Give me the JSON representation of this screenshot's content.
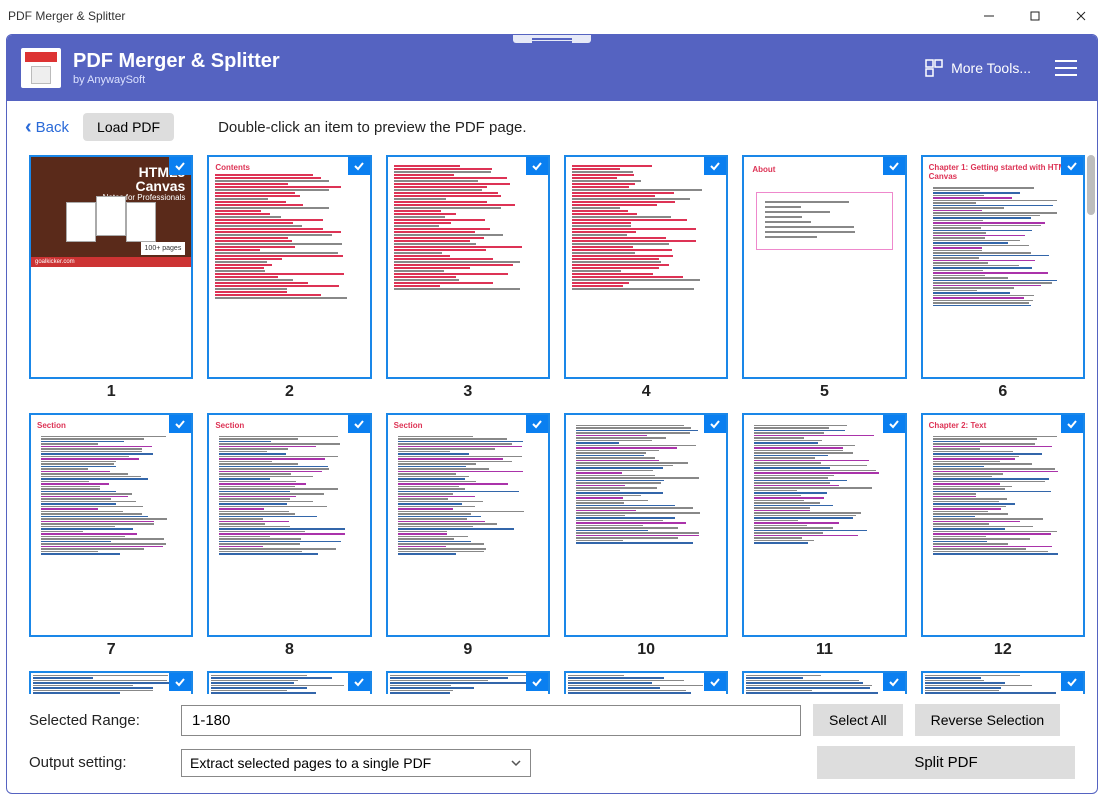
{
  "window": {
    "title": "PDF Merger & Splitter"
  },
  "header": {
    "title": "PDF Merger & Splitter",
    "subtitle": "by AnywaySoft",
    "more_tools": "More Tools..."
  },
  "toolbar": {
    "back": "Back",
    "load": "Load PDF",
    "hint": "Double-click an item to preview the PDF page."
  },
  "cover": {
    "title1": "HTML5",
    "title2": "Canvas",
    "sub": "Notes for Professionals",
    "badge": "100+ pages",
    "footer": "goalkicker.com"
  },
  "page_headings": {
    "p2": "Contents",
    "p4": "About",
    "p5a": "Chapter 1: Getting started with HTML5 Canvas",
    "p12": "Chapter 2: Text"
  },
  "pages": [
    {
      "num": "1"
    },
    {
      "num": "2"
    },
    {
      "num": "3"
    },
    {
      "num": "4"
    },
    {
      "num": "5"
    },
    {
      "num": "6"
    },
    {
      "num": "7"
    },
    {
      "num": "8"
    },
    {
      "num": "9"
    },
    {
      "num": "10"
    },
    {
      "num": "11"
    },
    {
      "num": "12"
    }
  ],
  "bottom": {
    "range_label": "Selected Range:",
    "range_value": "1-180",
    "select_all": "Select All",
    "reverse": "Reverse Selection",
    "output_label": "Output setting:",
    "output_value": "Extract selected pages to a single PDF",
    "split": "Split PDF"
  }
}
